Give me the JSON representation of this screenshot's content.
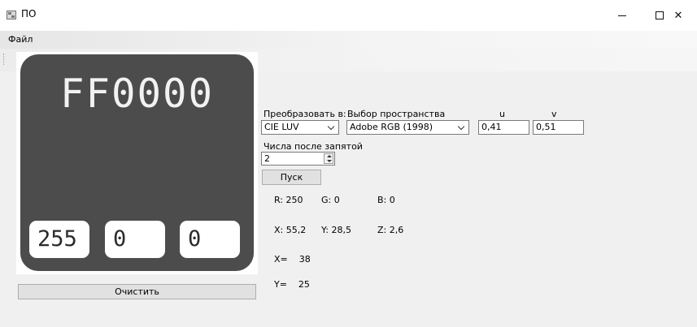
{
  "window": {
    "title": "ПО",
    "controls": {
      "minimize": "—",
      "close": "✕"
    }
  },
  "menu": {
    "file": "Файл"
  },
  "preview": {
    "hex": "FF0000",
    "r": "255",
    "g": "0",
    "b": "0",
    "background_color": "#4c4c4c"
  },
  "buttons": {
    "clear": "Очистить",
    "run": "Пуск"
  },
  "convert": {
    "label": "Преобразовать в:",
    "selected": "CIE LUV"
  },
  "space": {
    "label": "Выбор пространства",
    "selected": "Adobe RGB (1998)"
  },
  "uv": {
    "u_label": "u",
    "v_label": "v",
    "u_value": "0,41",
    "v_value": "0,51"
  },
  "decimals": {
    "label": "Числа после запятой",
    "value": "2"
  },
  "results": {
    "rgb": {
      "r": "R: 250",
      "g": "G: 0",
      "b": "B: 0"
    },
    "xyz": {
      "x": "X: 55,2",
      "y": "Y: 28,5",
      "z": "Z: 2,6"
    },
    "coords": {
      "x": "X=    38",
      "y": "Y=    25"
    }
  }
}
